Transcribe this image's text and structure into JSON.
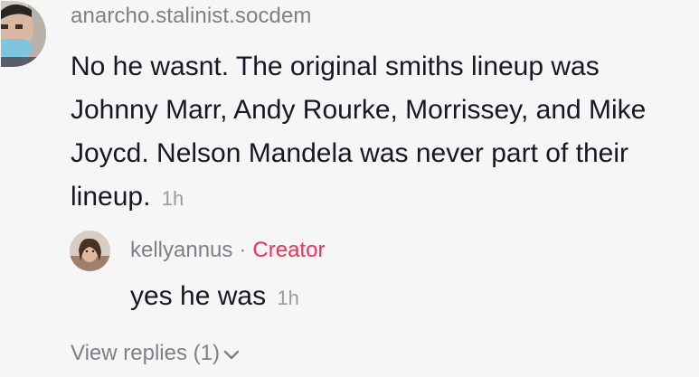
{
  "comment": {
    "username": "anarcho.stalinist.socdem",
    "text": "No he wasnt. The original smiths lineup was Johnny Marr, Andy Rourke, Morrissey, and Mike Joycd. Nelson Mandela was never part of their lineup.",
    "time": "1h"
  },
  "reply": {
    "username": "kellyannus",
    "separator": "·",
    "badge": "Creator",
    "text": "yes he was",
    "time": "1h"
  },
  "view_replies": {
    "label": "View replies (1)",
    "icon": "chevron-down-icon"
  },
  "colors": {
    "background": "#f6f6f6",
    "creator_badge": "#fe2c55",
    "secondary_text": "#7f8087"
  }
}
